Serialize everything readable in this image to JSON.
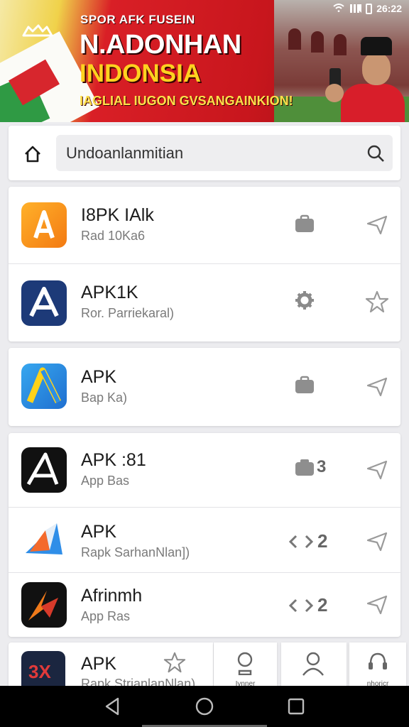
{
  "status_bar": {
    "time": "26:22"
  },
  "banner": {
    "line1": "SPOR AFK FUSEIN",
    "line2": "N.ADONHAN",
    "line3": "INDONSIA",
    "line4": "IAGLIAL IUGON GVSANGAINKION!",
    "colors": {
      "red": "#d91f26",
      "yellow": "#ffd21f",
      "green": "#2f9a44"
    }
  },
  "search": {
    "placeholder": "Undoanlanmitian"
  },
  "apps": [
    {
      "name": "I8PK IAlk",
      "sub": "Rad 10Ka6",
      "icon": "orange-a-icon",
      "action": "briefcase-icon"
    },
    {
      "name": "APK1K",
      "sub": "Ror. Parriekaral)",
      "icon": "navy-a-icon",
      "action": "gear-icon"
    },
    {
      "name": "APK",
      "sub": "Bap Ka)",
      "icon": "blue-yellow-a-icon",
      "action": "briefcase-icon"
    },
    {
      "name": "APK :81",
      "sub": "App Bas",
      "icon": "black-a-icon",
      "action": "camera-icon",
      "badge": "3"
    },
    {
      "name": "APK",
      "sub": "Rapk SarhanNlan])",
      "icon": "paper-plane-icon",
      "action": "code-icon",
      "badge": "2"
    },
    {
      "name": "Afrinmh",
      "sub": "App Ras",
      "icon": "orange-x-icon",
      "action": "code-icon",
      "badge": "2"
    }
  ],
  "bottom_app": {
    "name": "APK",
    "sub": "Rapk StrianlanNlan)",
    "icon_text": "3X"
  },
  "bottom_tabs": [
    {
      "label": "Ivnner",
      "icon": "trophy-icon"
    },
    {
      "label": "",
      "icon": "person-icon"
    },
    {
      "label": "nhoricr",
      "icon": "support-icon"
    }
  ]
}
